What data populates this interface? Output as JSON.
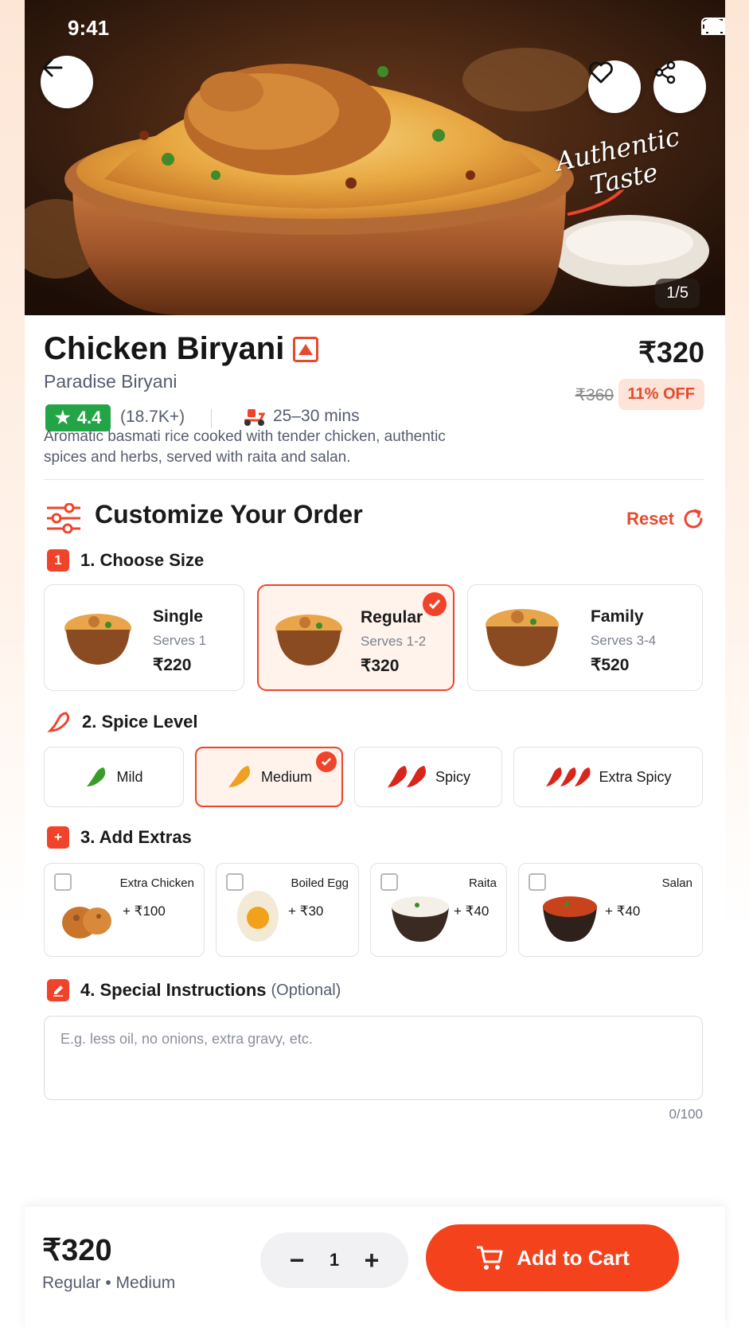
{
  "status_bar": {
    "time": "9:41"
  },
  "hero": {
    "tagline_line1": "Authentic",
    "tagline_line2": "Taste",
    "image_counter": "1/5"
  },
  "dish": {
    "name": "Chicken Biryani",
    "restaurant": "Paradise Biryani",
    "rating": "4.4",
    "rating_count": "(18.7K+)",
    "delivery_time": "25–30 mins",
    "price": "₹320",
    "original_price": "₹360",
    "discount": "11% OFF",
    "description": "Aromatic basmati rice cooked with tender chicken, authentic spices and herbs, served with raita and salan."
  },
  "customize": {
    "title": "Customize Your Order",
    "reset_label": "Reset",
    "size_section": {
      "number": "1",
      "title": "1. Choose Size"
    },
    "sizes": [
      {
        "name": "Single",
        "serves": "Serves 1",
        "price": "₹220",
        "selected": false
      },
      {
        "name": "Regular",
        "serves": "Serves 1-2",
        "price": "₹320",
        "selected": true
      },
      {
        "name": "Family",
        "serves": "Serves 3-4",
        "price": "₹520",
        "selected": false
      }
    ],
    "spice_section": {
      "title": "2. Spice Level"
    },
    "spice_levels": [
      {
        "label": "Mild",
        "selected": false
      },
      {
        "label": "Medium",
        "selected": true
      },
      {
        "label": "Spicy",
        "selected": false
      },
      {
        "label": "Extra Spicy",
        "selected": false
      }
    ],
    "extras_section": {
      "title": "3. Add Extras"
    },
    "extras": [
      {
        "name": "Extra Chicken",
        "price": "+ ₹100",
        "checked": false
      },
      {
        "name": "Boiled Egg",
        "price": "+ ₹30",
        "checked": false
      },
      {
        "name": "Raita",
        "price": "+ ₹40",
        "checked": false
      },
      {
        "name": "Salan",
        "price": "+ ₹40",
        "checked": false
      }
    ],
    "instructions_section": {
      "title": "4. Special Instructions",
      "optional": "(Optional)"
    },
    "instructions_placeholder": "E.g. less oil, no onions, extra gravy, etc.",
    "char_count": "0/100"
  },
  "cart_bar": {
    "total": "₹320",
    "summary": "Regular • Medium",
    "minus": "−",
    "quantity": "1",
    "plus": "+",
    "add_label": "Add to Cart"
  },
  "colors": {
    "accent": "#f0432a",
    "rating_green": "#22a447",
    "text_secondary": "#555c6e"
  }
}
